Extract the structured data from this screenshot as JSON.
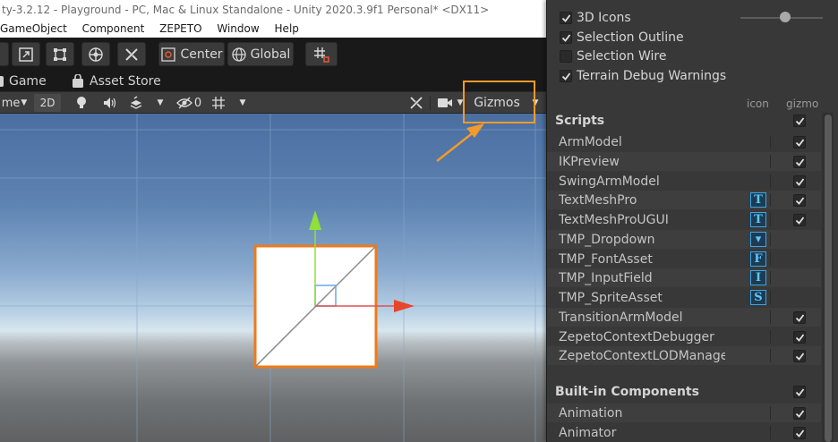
{
  "window": {
    "title": "ty-3.2.12 - Playground - PC, Mac & Linux Standalone - Unity 2020.3.9f1 Personal* <DX11>"
  },
  "menu": [
    "GameObject",
    "Component",
    "ZEPETO",
    "Window",
    "Help"
  ],
  "toolbar": {
    "center_label": "Center",
    "global_label": "Global"
  },
  "tabs": {
    "game": "Game",
    "asset_store": "Asset Store"
  },
  "scene_toolbar": {
    "shading_label": "me",
    "mode_2d": "2D",
    "hidden_count": "0",
    "gizmos_label": "Gizmos"
  },
  "gizmos_menu": {
    "options": [
      {
        "label": "3D Icons",
        "checked": true
      },
      {
        "label": "Selection Outline",
        "checked": true
      },
      {
        "label": "Selection Wire",
        "checked": false
      },
      {
        "label": "Terrain Debug Warnings",
        "checked": true
      }
    ],
    "icon_size_slider": 0.5,
    "columns": {
      "icon": "icon",
      "gizmo": "gizmo"
    },
    "scripts_section": {
      "title": "Scripts",
      "checked": true
    },
    "scripts": [
      {
        "name": "ArmModel",
        "icon": "",
        "checked": true
      },
      {
        "name": "IKPreview",
        "icon": "",
        "checked": true
      },
      {
        "name": "SwingArmModel",
        "icon": "",
        "checked": true
      },
      {
        "name": "TextMeshPro",
        "icon": "T",
        "checked": true
      },
      {
        "name": "TextMeshProUGUI",
        "icon": "T",
        "checked": true
      },
      {
        "name": "TMP_Dropdown",
        "icon": "▾",
        "checked": false
      },
      {
        "name": "TMP_FontAsset",
        "icon": "F",
        "checked": false
      },
      {
        "name": "TMP_InputField",
        "icon": "I",
        "checked": false
      },
      {
        "name": "TMP_SpriteAsset",
        "icon": "S",
        "checked": false
      },
      {
        "name": "TransitionArmModel",
        "icon": "",
        "checked": true
      },
      {
        "name": "ZepetoContextDebugger",
        "icon": "",
        "checked": true
      },
      {
        "name": "ZepetoContextLODManager",
        "icon": "",
        "checked": true
      }
    ],
    "builtin_section": {
      "title": "Built-in Components",
      "checked": true
    },
    "builtin": [
      {
        "name": "Animation",
        "checked": true
      },
      {
        "name": "Animator",
        "checked": true
      }
    ]
  },
  "colors": {
    "highlight": "#f39a2b",
    "panel_bg": "#383838",
    "icon_accent": "#3aa7e6"
  }
}
